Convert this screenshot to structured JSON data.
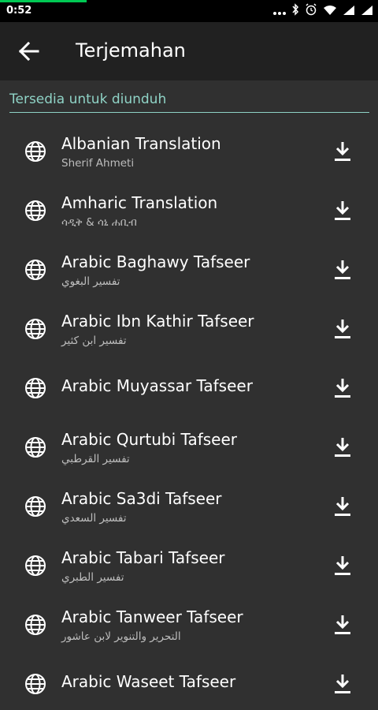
{
  "status_bar": {
    "time": "0:52"
  },
  "app_bar": {
    "title": "Terjemahan"
  },
  "section": {
    "header": "Tersedia untuk diunduh"
  },
  "items": [
    {
      "name": "Albanian Translation",
      "subtitle": "Sherif Ahmeti"
    },
    {
      "name": "Amharic Translation",
      "subtitle": "ሳዲቅ & ሳኒ ሐቢብ"
    },
    {
      "name": "Arabic Baghawy Tafseer",
      "subtitle": "تفسير البغوي"
    },
    {
      "name": "Arabic Ibn Kathir Tafseer",
      "subtitle": "تفسير ابن كثير"
    },
    {
      "name": "Arabic Muyassar Tafseer",
      "subtitle": ""
    },
    {
      "name": "Arabic Qurtubi Tafseer",
      "subtitle": "تفسير القرطبي"
    },
    {
      "name": "Arabic Sa3di Tafseer",
      "subtitle": "تفسير السعدي"
    },
    {
      "name": "Arabic Tabari Tafseer",
      "subtitle": "تفسير الطبري"
    },
    {
      "name": "Arabic Tanweer Tafseer",
      "subtitle": "التحرير والتنوير لابن عاشور"
    },
    {
      "name": "Arabic Waseet Tafseer",
      "subtitle": ""
    }
  ],
  "colors": {
    "accent": "#8fd3c6",
    "progress": "#00c853",
    "background": "#303030",
    "toolbar": "#212121"
  }
}
